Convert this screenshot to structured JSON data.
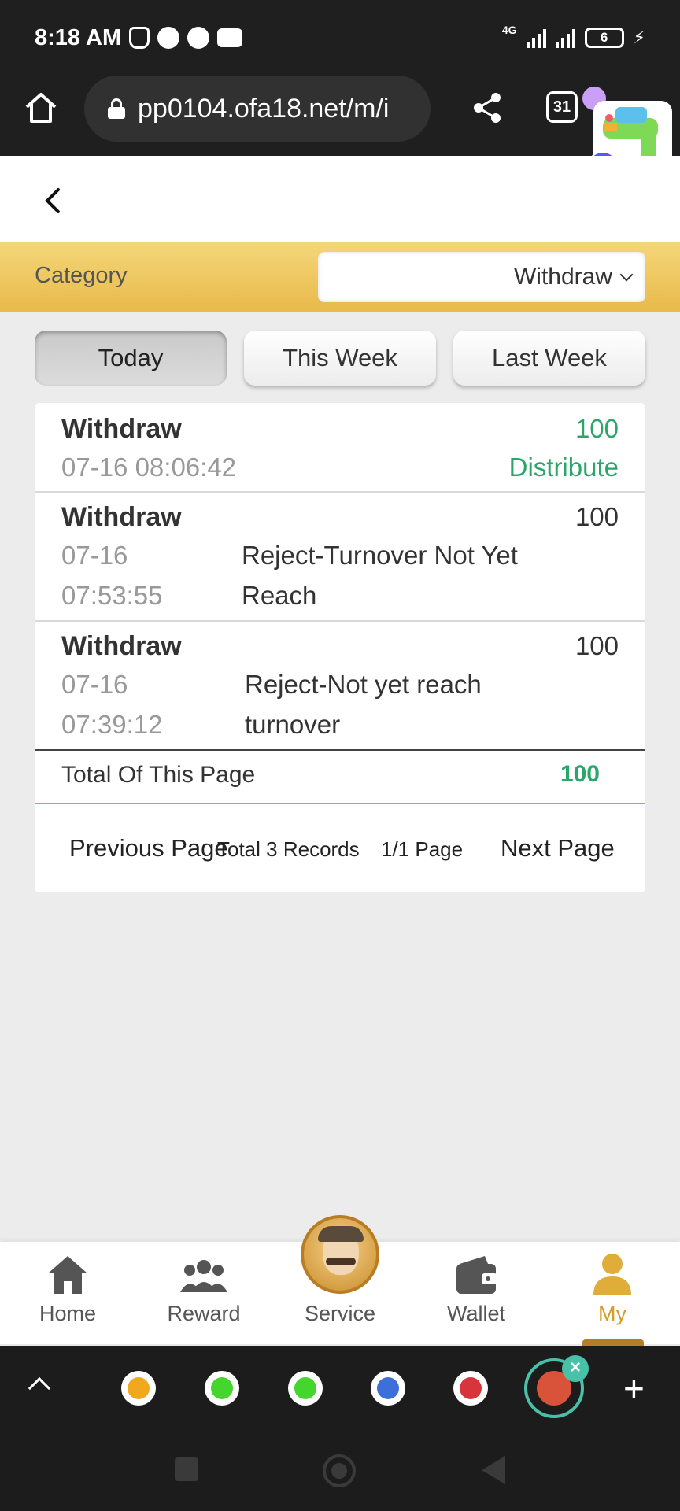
{
  "status_bar": {
    "time": "8:18 AM",
    "network": "4G",
    "battery": "6"
  },
  "browser": {
    "url": "pp0104.ofa18.net/m/i",
    "tab_count": "31"
  },
  "filter": {
    "category_label": "Category",
    "category_value": "Withdraw",
    "periods": [
      "Today",
      "This Week",
      "Last Week"
    ],
    "active_period": "Today"
  },
  "records": [
    {
      "type": "Withdraw",
      "amount": "100",
      "date": "07-16",
      "time": "08:06:42",
      "datetime": "07-16 08:06:42",
      "status": "Distribute"
    },
    {
      "type": "Withdraw",
      "amount": "100",
      "date": "07-16",
      "time": "07:53:55",
      "status_line1": "Reject-Turnover Not Yet",
      "status_line2": "Reach"
    },
    {
      "type": "Withdraw",
      "amount": "100",
      "date": "07-16",
      "time": "07:39:12",
      "status_line1": "Reject-Not yet reach",
      "status_line2": "turnover"
    }
  ],
  "summary": {
    "total_label": "Total Of This Page",
    "total_value": "100"
  },
  "pagination": {
    "previous": "Previous Page",
    "total_records": "Total 3 Records",
    "page_info": "1/1 Page",
    "next": "Next Page"
  },
  "bottom_nav": {
    "items": [
      {
        "label": "Home",
        "icon": "home-icon"
      },
      {
        "label": "Reward",
        "icon": "group-icon"
      },
      {
        "label": "Service",
        "icon": "service-avatar-icon"
      },
      {
        "label": "Wallet",
        "icon": "wallet-icon"
      },
      {
        "label": "My",
        "icon": "user-icon"
      }
    ],
    "active": "My"
  },
  "colors": {
    "accent_gold": "#e9b94a",
    "status_green": "#2aa66a",
    "active_nav": "#d59e2a"
  }
}
